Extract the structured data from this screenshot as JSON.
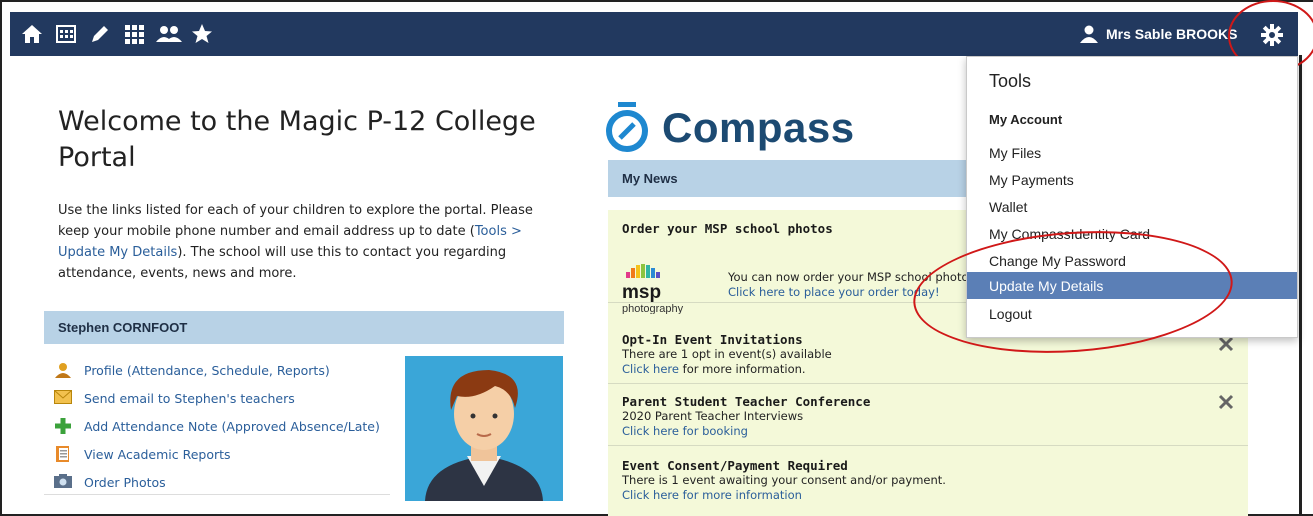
{
  "topbar": {
    "icons": [
      "home-icon",
      "calendar-icon",
      "pencil-icon",
      "grid-icon",
      "people-icon",
      "star-icon"
    ],
    "user_name": "Mrs Sable BROOKS"
  },
  "welcome": {
    "title": "Welcome to the Magic P-12 College Portal",
    "text_1": "Use the links listed for each of your children to explore the portal. Please keep your mobile phone number and email address up to date (",
    "text_link": "Tools > Update My Details",
    "text_2": "). The school will use this to contact you regarding attendance, events, news and more."
  },
  "student": {
    "name": "Stephen CORNFOOT",
    "links": [
      "Profile (Attendance, Schedule, Reports)",
      "Send email to Stephen's teachers",
      "Add Attendance Note (Approved Absence/Late)",
      "View Academic Reports",
      "Order Photos"
    ]
  },
  "compass": {
    "logo_text": "Compass"
  },
  "news": {
    "header": "My News",
    "items": [
      {
        "title": "Order your MSP school photos",
        "line": "You can now order your MSP school photos",
        "link": "Click here to place your order today!",
        "logo_main": "msp",
        "logo_sub": "photography"
      },
      {
        "title": "Opt-In Event Invitations",
        "line": "There are 1 opt in event(s) available",
        "link": "Click here",
        "link_suffix": " for more information."
      },
      {
        "title": "Parent Student Teacher Conference",
        "line": "2020 Parent Teacher Interviews",
        "link": "Click here for booking"
      },
      {
        "title": "Event Consent/Payment Required",
        "line": "There is 1 event awaiting your consent and/or payment.",
        "link": "Click here for more information"
      }
    ]
  },
  "dropdown": {
    "title": "Tools",
    "section": "My Account",
    "items": [
      "My Files",
      "My Payments",
      "Wallet",
      "My CompassIdentity Card",
      "Change My Password",
      "Update My Details",
      "Logout"
    ],
    "active_item": "Update My Details"
  },
  "colors": {
    "topbar": "#22395f",
    "section_header": "#b8d2e6",
    "news_bg": "#f4f9d9",
    "link": "#2a5e9a",
    "highlight": "#5b7fb6",
    "annotation": "#d01818"
  }
}
